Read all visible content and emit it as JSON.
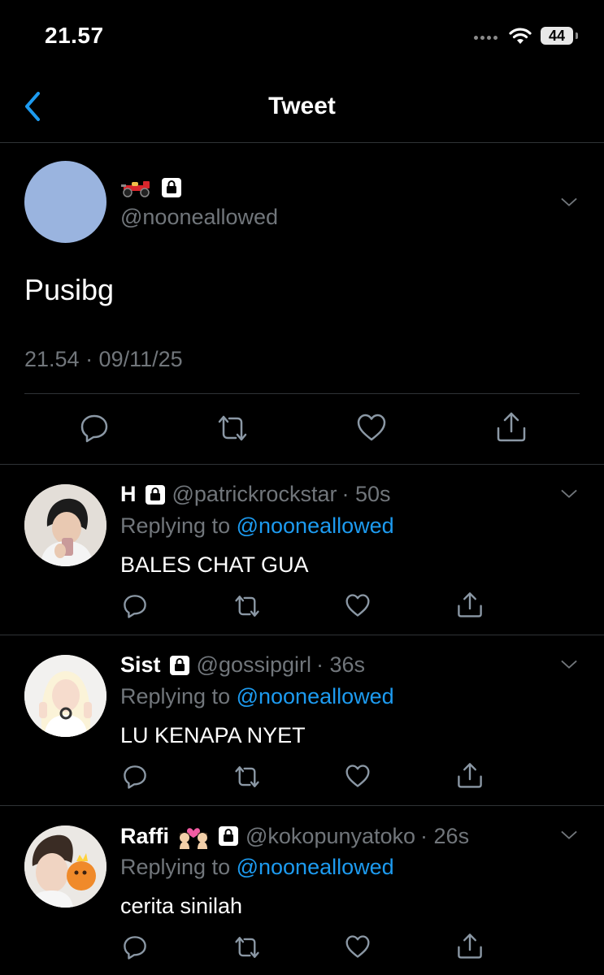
{
  "status_bar": {
    "time": "21.57",
    "battery": "44"
  },
  "nav": {
    "title": "Tweet"
  },
  "main_tweet": {
    "handle": "@nooneallowed",
    "text": "Pusibg",
    "timestamp": "21.54 · 09/11/25",
    "avatar_color": "#9ab4df"
  },
  "replies": [
    {
      "name": "H",
      "handle": "@patrickrockstar",
      "time": "· 50s",
      "replying_prefix": "Replying to ",
      "replying_to": "@nooneallowed",
      "text": "BALES CHAT GUA"
    },
    {
      "name": "Sist",
      "handle": "@gossipgirl",
      "time": "· 36s",
      "replying_prefix": "Replying to ",
      "replying_to": "@nooneallowed",
      "text": "LU KENAPA NYET"
    },
    {
      "name": "Raffi",
      "handle": "@kokopunyatoko",
      "time": "· 26s",
      "replying_prefix": "Replying to ",
      "replying_to": "@nooneallowed",
      "text": "cerita sinilah"
    }
  ],
  "colors": {
    "accent": "#1d9bf0",
    "muted": "#71767b",
    "divider": "#2f3336",
    "background": "#000000"
  },
  "icons": [
    "back-chevron-icon",
    "lock-icon",
    "race-car-icon",
    "chevron-down-icon",
    "reply-icon",
    "retweet-icon",
    "like-icon",
    "share-icon",
    "wifi-icon"
  ]
}
